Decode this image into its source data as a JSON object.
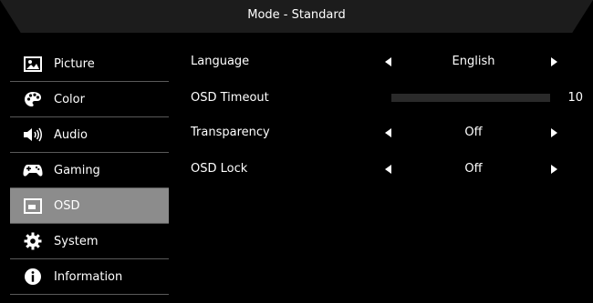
{
  "header": {
    "title": "Mode - Standard"
  },
  "sidebar": {
    "items": [
      {
        "label": "Picture",
        "icon": "picture-icon",
        "active": false
      },
      {
        "label": "Color",
        "icon": "palette-icon",
        "active": false
      },
      {
        "label": "Audio",
        "icon": "speaker-icon",
        "active": false
      },
      {
        "label": "Gaming",
        "icon": "gamepad-icon",
        "active": false
      },
      {
        "label": "OSD",
        "icon": "osd-icon",
        "active": true
      },
      {
        "label": "System",
        "icon": "gear-icon",
        "active": false
      },
      {
        "label": "Information",
        "icon": "info-icon",
        "active": false
      }
    ]
  },
  "settings": {
    "language": {
      "label": "Language",
      "value": "English"
    },
    "osd_timeout": {
      "label": "OSD Timeout",
      "value": "10",
      "level": 0.0
    },
    "transparency": {
      "label": "Transparency",
      "value": "Off"
    },
    "osd_lock": {
      "label": "OSD Lock",
      "value": "Off"
    }
  },
  "colors": {
    "background": "#000000",
    "header": "#1c1c1c",
    "active_item": "#8c8c8c",
    "divider": "#5a5a5a",
    "text": "#ffffff"
  }
}
